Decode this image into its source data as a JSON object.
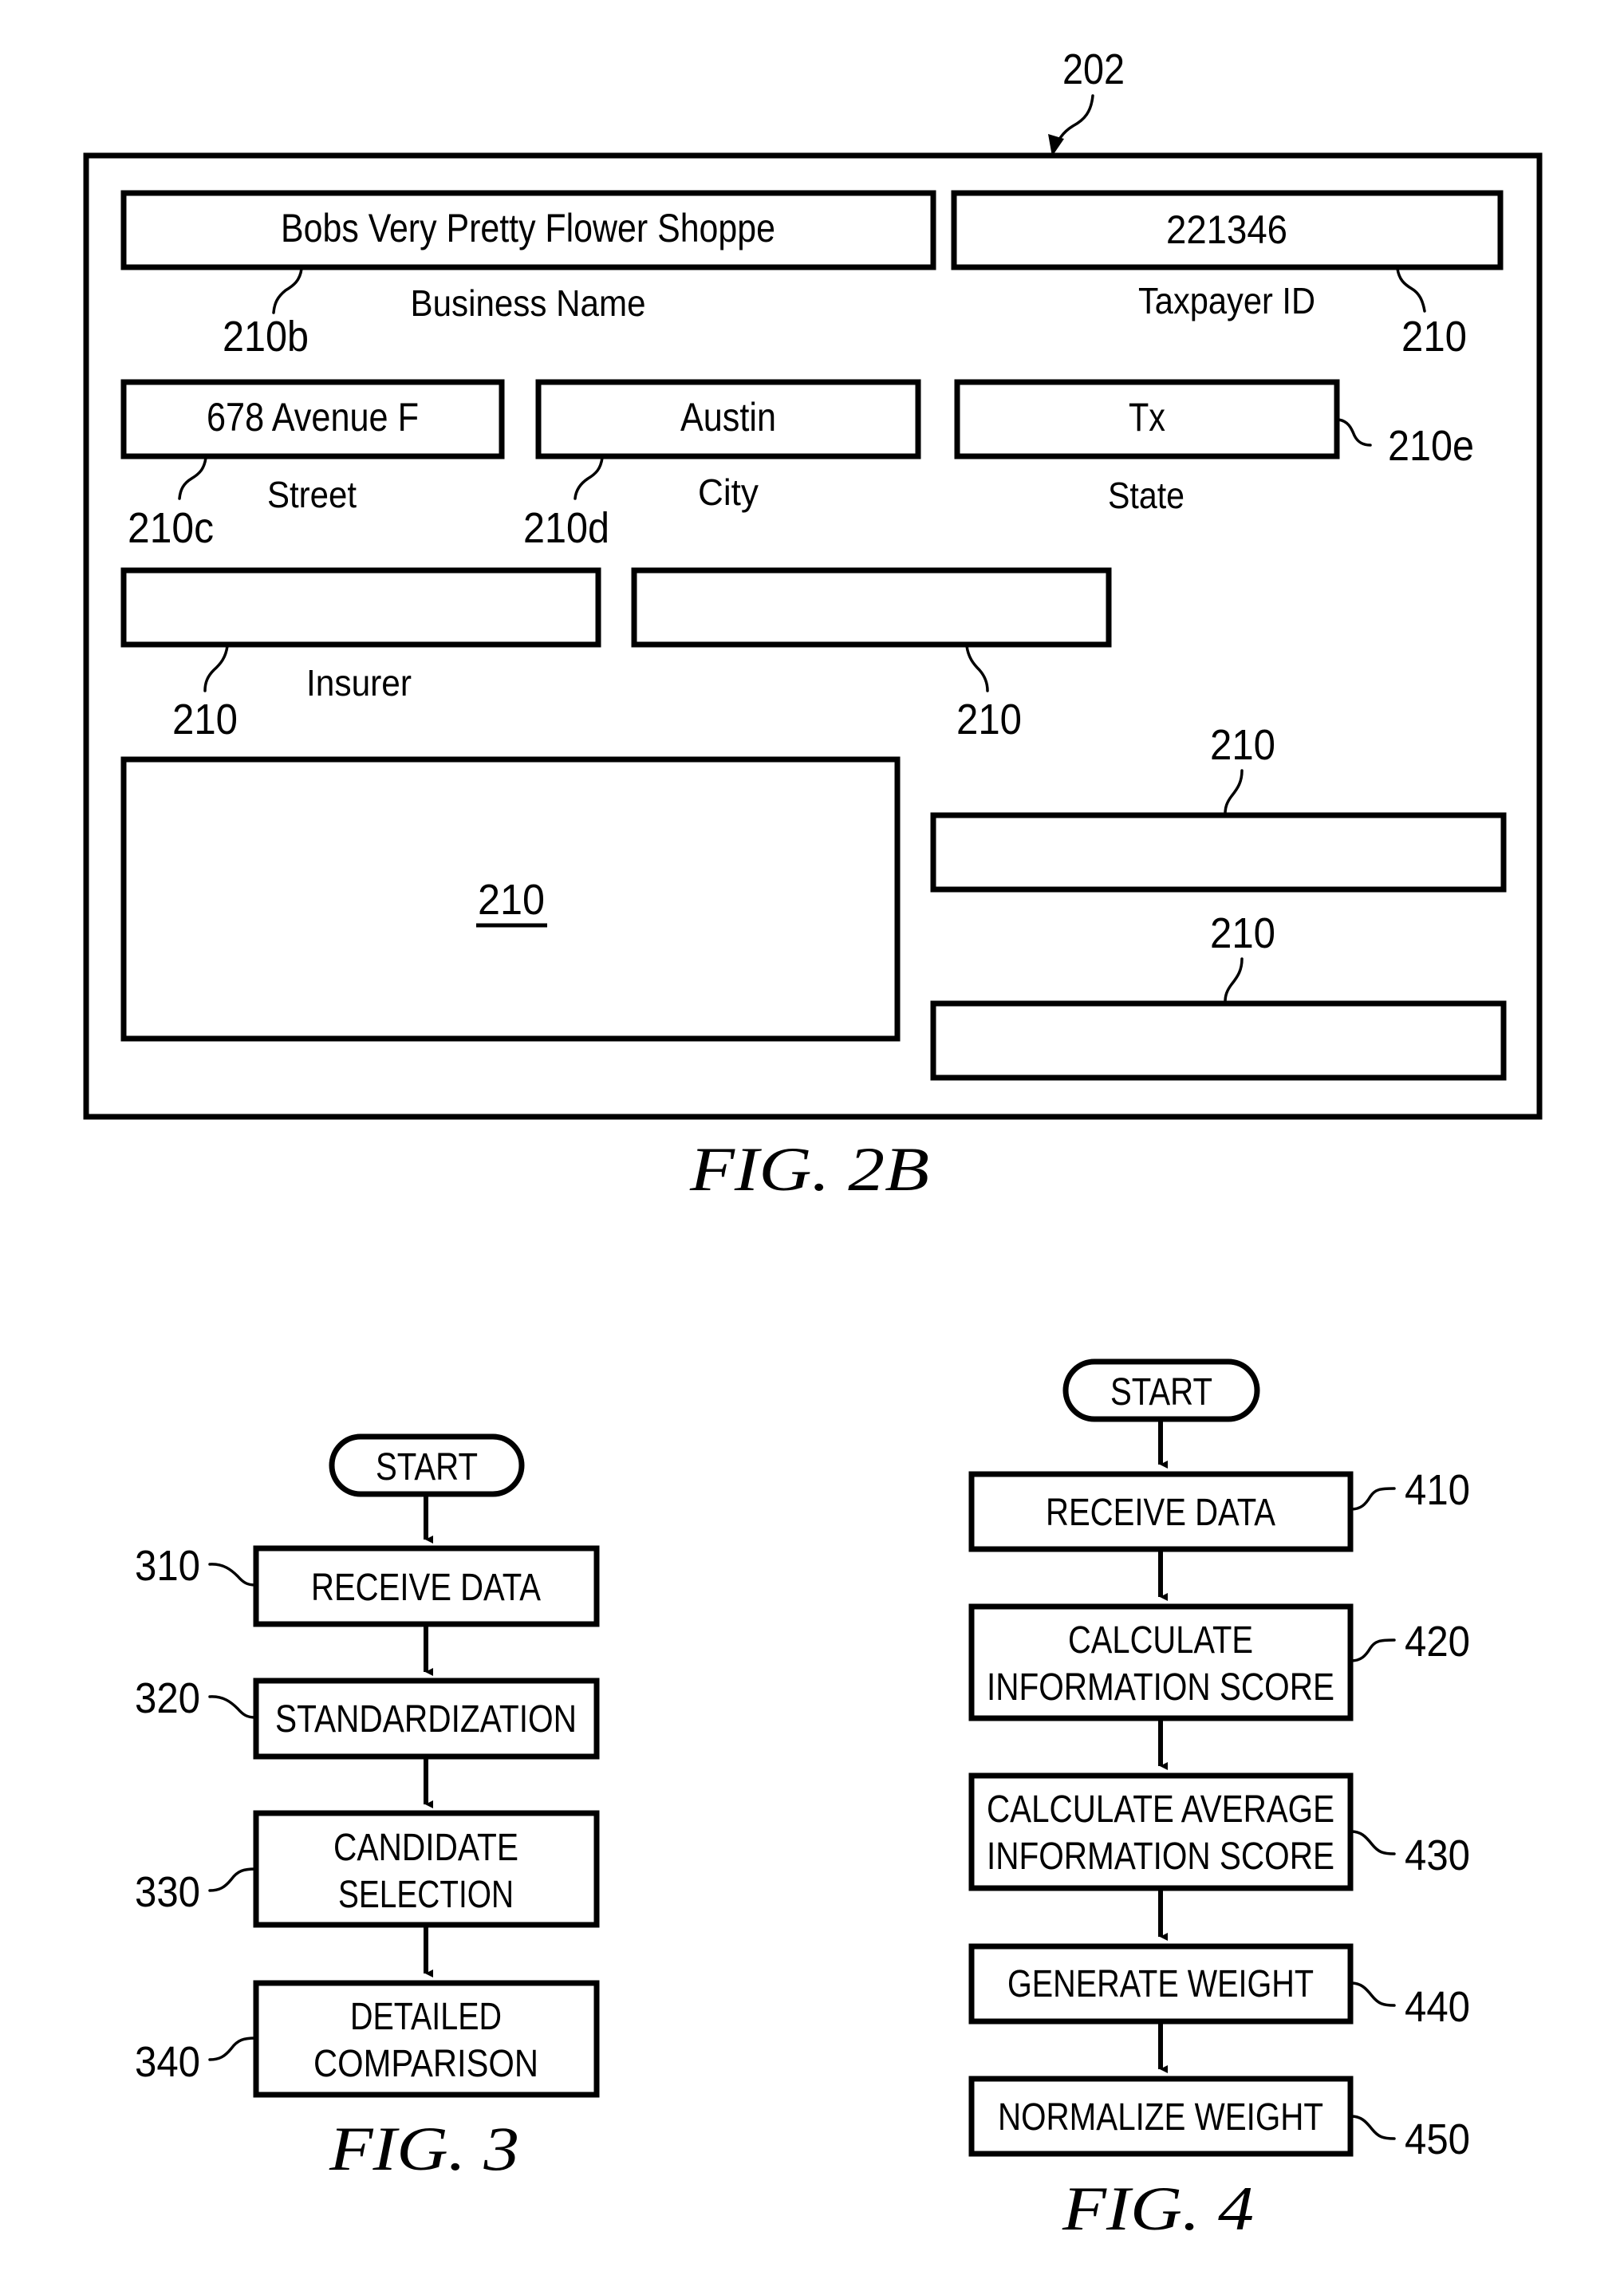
{
  "fig2b": {
    "caption": "FIG. 2B",
    "form_ref": "202",
    "fields": [
      {
        "id": "business-name",
        "value": "Bobs Very Pretty Flower Shoppe",
        "label": "Business Name",
        "ref": "210b"
      },
      {
        "id": "taxpayer-id",
        "value": "221346",
        "label": "Taxpayer ID",
        "ref": "210"
      },
      {
        "id": "street",
        "value": "678 Avenue F",
        "label": "Street",
        "ref": "210c"
      },
      {
        "id": "city",
        "value": "Austin",
        "label": "City",
        "ref": "210d"
      },
      {
        "id": "state",
        "value": "Tx",
        "label": "State",
        "ref": "210e"
      },
      {
        "id": "insurer",
        "value": "",
        "label": "Insurer",
        "ref": "210"
      },
      {
        "id": "field-row3b",
        "value": "",
        "label": "",
        "ref": "210"
      },
      {
        "id": "large-field",
        "value": "",
        "label": "",
        "ref": "210"
      },
      {
        "id": "right-field-1",
        "value": "",
        "label": "",
        "ref": "210"
      },
      {
        "id": "right-field-2",
        "value": "",
        "label": "",
        "ref": "210"
      }
    ]
  },
  "fig3": {
    "caption": "FIG. 3",
    "start": "START",
    "steps": [
      {
        "ref": "310",
        "lines": [
          "RECEIVE DATA"
        ]
      },
      {
        "ref": "320",
        "lines": [
          "STANDARDIZATION"
        ]
      },
      {
        "ref": "330",
        "lines": [
          "CANDIDATE",
          "SELECTION"
        ]
      },
      {
        "ref": "340",
        "lines": [
          "DETAILED",
          "COMPARISON"
        ]
      }
    ]
  },
  "fig4": {
    "caption": "FIG. 4",
    "start": "START",
    "steps": [
      {
        "ref": "410",
        "lines": [
          "RECEIVE DATA"
        ]
      },
      {
        "ref": "420",
        "lines": [
          "CALCULATE",
          "INFORMATION SCORE"
        ]
      },
      {
        "ref": "430",
        "lines": [
          "CALCULATE AVERAGE",
          "INFORMATION SCORE"
        ]
      },
      {
        "ref": "440",
        "lines": [
          "GENERATE WEIGHT"
        ]
      },
      {
        "ref": "450",
        "lines": [
          "NORMALIZE WEIGHT"
        ]
      }
    ]
  }
}
